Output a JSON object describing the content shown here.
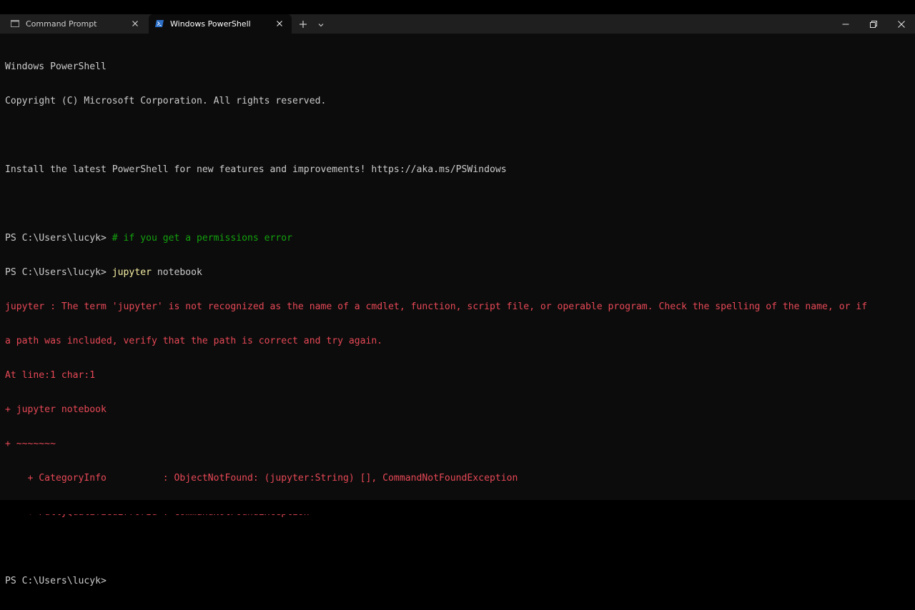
{
  "tabs": [
    {
      "label": "Command Prompt",
      "icon": "cmd-icon"
    },
    {
      "label": "Windows PowerShell",
      "icon": "powershell-icon"
    }
  ],
  "toolbar": {
    "new_tab_icon": "plus-icon",
    "dropdown_icon": "chevron-down-icon"
  },
  "window_controls": {
    "minimize_icon": "minimize-icon",
    "restore_icon": "restore-icon",
    "close_icon": "close-icon"
  },
  "terminal": {
    "header1": "Windows PowerShell",
    "header2": "Copyright (C) Microsoft Corporation. All rights reserved.",
    "install_msg": "Install the latest PowerShell for new features and improvements! https://aka.ms/PSWindows",
    "prompt": "PS C:\\Users\\lucyk> ",
    "comment": "# if you get a permissions error",
    "cmd_name": "jupyter",
    "cmd_args": " notebook",
    "error_lines": [
      "jupyter : The term 'jupyter' is not recognized as the name of a cmdlet, function, script file, or operable program. Check the spelling of the name, or if",
      "a path was included, verify that the path is correct and try again.",
      "At line:1 char:1",
      "+ jupyter notebook",
      "+ ~~~~~~~",
      "    + CategoryInfo          : ObjectNotFound: (jupyter:String) [], CommandNotFoundException",
      "    + FullyQualifiedErrorId : CommandNotFoundException"
    ],
    "final_prompt": "PS C:\\Users\\lucyk>"
  },
  "colors": {
    "background": "#0c0c0c",
    "text": "#cccccc",
    "error": "#e74856",
    "comment": "#13a10e",
    "command": "#f9f1a5"
  }
}
